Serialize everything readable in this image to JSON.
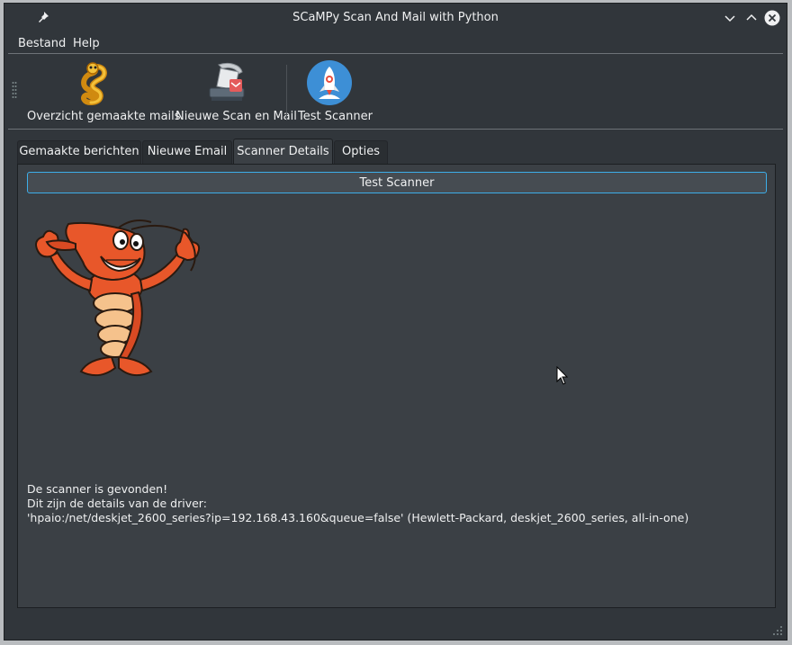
{
  "window": {
    "title": "SCaMPy Scan And Mail with Python"
  },
  "menu": {
    "file": "Bestand",
    "help": "Help"
  },
  "toolbar": {
    "items": [
      {
        "label": "Overzicht gemaakte mails",
        "icon": "snake-icon"
      },
      {
        "label": "Nieuwe Scan en Mail",
        "icon": "scanner-icon"
      },
      {
        "label": "Test Scanner",
        "icon": "rocket-icon"
      }
    ]
  },
  "tabs": [
    {
      "label": "Gemaakte berichten",
      "active": false
    },
    {
      "label": "Nieuwe Email",
      "active": false
    },
    {
      "label": "Scanner Details",
      "active": true
    },
    {
      "label": "Opties",
      "active": false
    }
  ],
  "panel": {
    "button_label": "Test Scanner",
    "lines": [
      "De scanner is gevonden!",
      "Dit zijn de details van de driver:",
      "'hpaio:/net/deskjet_2600_series?ip=192.168.43.160&queue=false' (Hewlett-Packard, deskjet_2600_series, all-in-one)"
    ]
  },
  "colors": {
    "window_bg": "#31363b",
    "panel_bg": "#3b4045",
    "accent": "#3daee9",
    "text": "#eff0f1"
  }
}
